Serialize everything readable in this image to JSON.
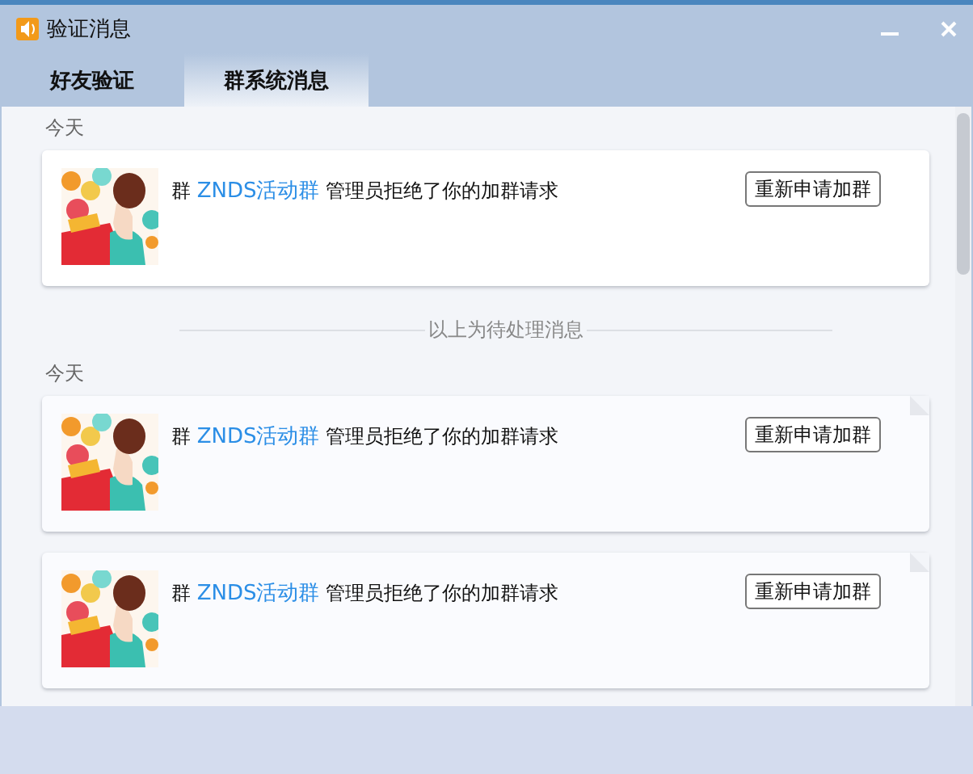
{
  "window": {
    "title": "验证消息"
  },
  "tabs": [
    {
      "label": "好友验证",
      "selected": false
    },
    {
      "label": "群系统消息",
      "selected": true
    }
  ],
  "sections": [
    {
      "kind": "group",
      "label": "今天",
      "messages": [
        {
          "prefix": "群",
          "group": "ZNDS活动群",
          "text": "管理员拒绝了你的加群请求",
          "button": "重新申请加群",
          "unread": false
        }
      ]
    },
    {
      "kind": "divider",
      "label": "以上为待处理消息"
    },
    {
      "kind": "group",
      "label": "今天",
      "messages": [
        {
          "prefix": "群",
          "group": "ZNDS活动群",
          "text": "管理员拒绝了你的加群请求",
          "button": "重新申请加群",
          "unread": true
        },
        {
          "prefix": "群",
          "group": "ZNDS活动群",
          "text": "管理员拒绝了你的加群请求",
          "button": "重新申请加群",
          "unread": true
        }
      ]
    }
  ]
}
